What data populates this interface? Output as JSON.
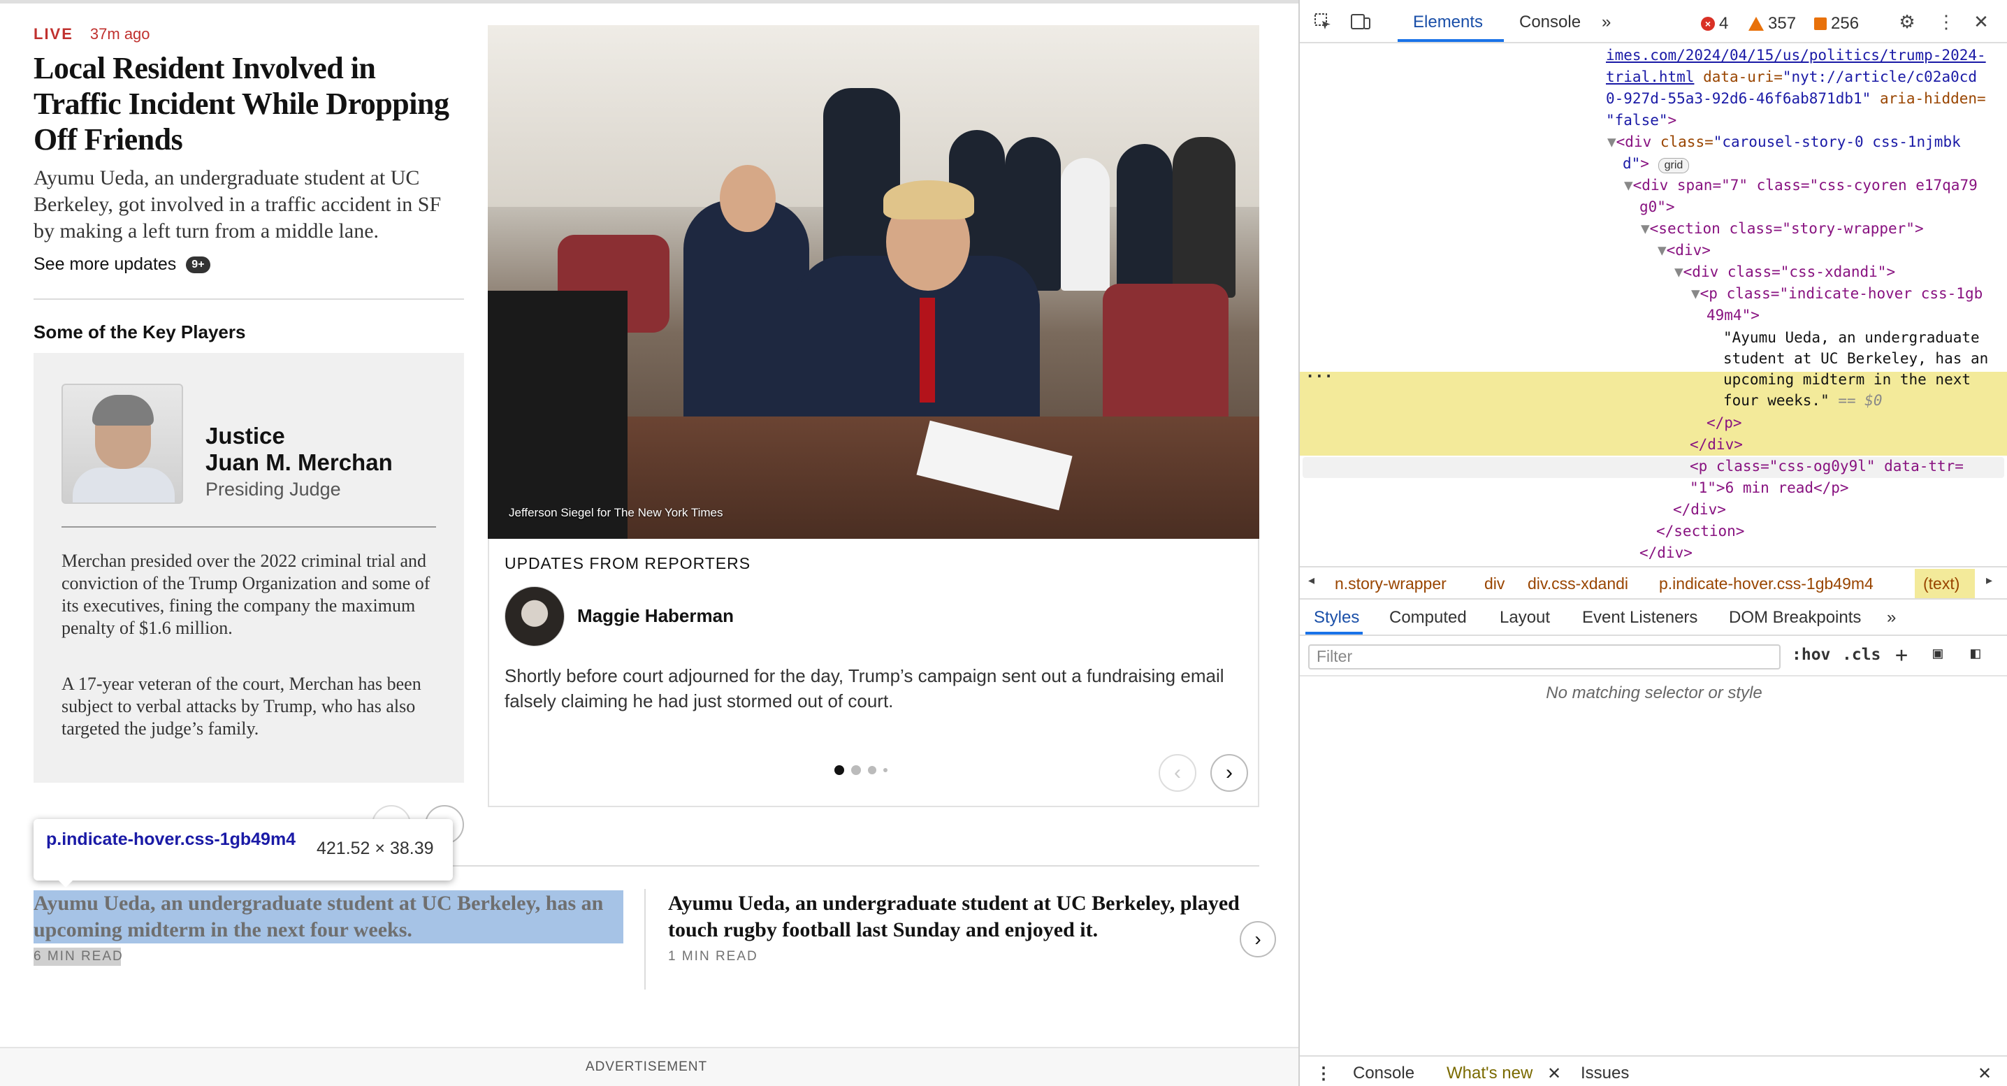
{
  "article": {
    "live_label": "LIVE",
    "time_ago": "37m ago",
    "headline": "Local Resident Involved in Traffic Incident While Dropping Off Friends",
    "summary": "Ayumu Ueda, an undergraduate student at UC Berkeley, got involved in a traffic accident in SF by making a left turn from a middle lane.",
    "see_more": "See more updates",
    "see_more_badge": "9+"
  },
  "key_players": {
    "title": "Some of the Key Players",
    "name_line1": "Justice",
    "name_line2": "Juan M. Merchan",
    "role": "Presiding Judge",
    "bio1": "Merchan presided over the 2022 criminal trial and conviction of the Trump Organization and some of its executives, fining the company the maximum penalty of $1.6 million.",
    "bio2": "A 17-year veteran of the court, Merchan has been subject to verbal attacks by Trump, who has also targeted the judge’s family."
  },
  "photo": {
    "credit": "Jefferson Siegel for The New York Times"
  },
  "reporter_card": {
    "label": "UPDATES FROM REPORTERS",
    "reporter_name": "Maggie Haberman",
    "text": "Shortly before court adjourned for the day, Trump’s campaign sent out a fundraising email falsely claiming he had just stormed out of court.",
    "prev_icon": "‹",
    "next_icon": "›"
  },
  "inspector_tooltip": {
    "selector": "p.indicate-hover.css-1gb49m4",
    "size": "421.52 × 38.39"
  },
  "stories": [
    {
      "title": "Ayumu Ueda, an undergraduate student at UC Berkeley, has an upcoming midterm in the next four weeks.",
      "read_time": "6 MIN READ"
    },
    {
      "title": "Ayumu Ueda, an undergraduate student at UC Berkeley, played touch rugby football last Sunday and enjoyed it.",
      "read_time": "1 MIN READ"
    }
  ],
  "stories_next_icon": "›",
  "advertisement_label": "ADVERTISEMENT",
  "devtools": {
    "tabs": [
      "Elements",
      "Console"
    ],
    "more_tabs": "»",
    "errors": "4",
    "warnings": "357",
    "issues": "256",
    "dom": {
      "l1": "imes.com/2024/04/15/us/politics/trump-2024-",
      "l2a": "trial.html",
      "l2b": " data-uri=",
      "l2c": "\"nyt://article/c02a0cd",
      "l3": "0-927d-55a3-92d6-46f6ab871db1\"",
      "l3b": " aria-hidden=",
      "l4": "\"false\"",
      "l4b": ">",
      "l5tag": "<div ",
      "l5attr": "class=",
      "l5val": "\"carousel-story-0 css-1njmbk",
      "l6val": "d\"",
      "l6tag": ">",
      "grid_pill": "grid",
      "l7": "<div span=\"7\" class=\"css-cyoren e17qa79",
      "l8": "g0\">",
      "l9": "<section class=\"story-wrapper\">",
      "l10": "<div>",
      "l11": "<div class=\"css-xdandi\">",
      "l12": "<p class=\"indicate-hover css-1gb",
      "l13": "49m4\">",
      "sel1": "\"Ayumu Ueda, an undergraduate",
      "sel2": "student at UC Berkeley, has an",
      "sel3": "upcoming midterm in the next",
      "sel4": "four weeks.\"",
      "sel_eq": " == $0",
      "l18": "</p>",
      "l19": "</div>",
      "l20": "<p class=\"css-og0y9l\" data-ttr=",
      "l21": "\"1\">6 min read</p>",
      "l22": "</div>",
      "l23": "</section>",
      "l24": "</div>"
    },
    "breadcrumbs": [
      "n.story-wrapper",
      "div",
      "div.css-xdandi",
      "p.indicate-hover.css-1gb49m4",
      "(text)"
    ],
    "style_tabs": [
      "Styles",
      "Computed",
      "Layout",
      "Event Listeners",
      "DOM Breakpoints",
      "»"
    ],
    "filter_placeholder": "Filter",
    "hov": ":hov",
    "cls": ".cls",
    "no_match": "No matching selector or style",
    "drawer_tabs": [
      "Console",
      "What's new",
      "Issues"
    ]
  },
  "colors": {
    "live_red": "#c0312e",
    "selection_blue": "#a6c3e6",
    "devtools_selected": "#f3ea9a",
    "devtools_accent": "#1a73e8"
  }
}
